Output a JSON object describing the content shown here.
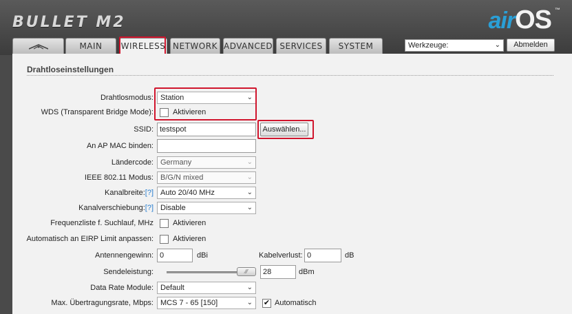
{
  "header": {
    "brand": "BULLET M2",
    "logo_air": "air",
    "logo_os": "OS",
    "logo_tm": "™"
  },
  "tabs": [
    {
      "label": "",
      "icon": "ubiquiti-logo-icon"
    },
    {
      "label": "MAIN"
    },
    {
      "label": "WIRELESS",
      "active": true
    },
    {
      "label": "NETWORK"
    },
    {
      "label": "ADVANCED"
    },
    {
      "label": "SERVICES"
    },
    {
      "label": "SYSTEM"
    }
  ],
  "toolbar": {
    "tools_value": "Werkzeuge:",
    "logout_label": "Abmelden"
  },
  "section": {
    "title": "Drahtloseinstellungen"
  },
  "form": {
    "wireless_mode": {
      "label": "Drahtlosmodus:",
      "value": "Station"
    },
    "wds": {
      "label": "WDS (Transparent Bridge Mode):",
      "checkbox_label": "Aktivieren",
      "checked": false
    },
    "ssid": {
      "label": "SSID:",
      "value": "testspot",
      "button": "Auswählen..."
    },
    "ap_mac": {
      "label": "An AP MAC binden:",
      "value": ""
    },
    "country": {
      "label": "Ländercode:",
      "value": "Germany"
    },
    "ieee_mode": {
      "label": "IEEE 802.11 Modus:",
      "value": "B/G/N mixed"
    },
    "channel_width": {
      "label": "Kanalbreite:",
      "help": "[?]",
      "value": "Auto 20/40 MHz"
    },
    "channel_shift": {
      "label": "Kanalverschiebung:",
      "help": "[?]",
      "value": "Disable"
    },
    "freq_list": {
      "label": "Frequenzliste f. Suchlauf, MHz",
      "checkbox_label": "Aktivieren",
      "checked": false
    },
    "eirp": {
      "label": "Automatisch an EIRP Limit anpassen:",
      "checkbox_label": "Aktivieren",
      "checked": false
    },
    "antenna_gain": {
      "label": "Antennengewinn:",
      "value": "0",
      "unit": "dBi",
      "cable_loss_label": "Kabelverlust:",
      "cable_loss_value": "0",
      "cable_loss_unit": "dB"
    },
    "tx_power": {
      "label": "Sendeleistung:",
      "value": "28",
      "unit": "dBm",
      "slider_level": 1.0
    },
    "data_rate_module": {
      "label": "Data Rate Module:",
      "value": "Default"
    },
    "max_rate": {
      "label": "Max. Übertragungsrate, Mbps:",
      "value": "MCS 7 - 65 [150]",
      "auto_label": "Automatisch",
      "auto_checked": true,
      "check_mark": "✔"
    }
  },
  "colors": {
    "accent_blue": "#2a9fd6",
    "highlight_red": "#d0142c",
    "help_link": "#2a7fd0"
  }
}
